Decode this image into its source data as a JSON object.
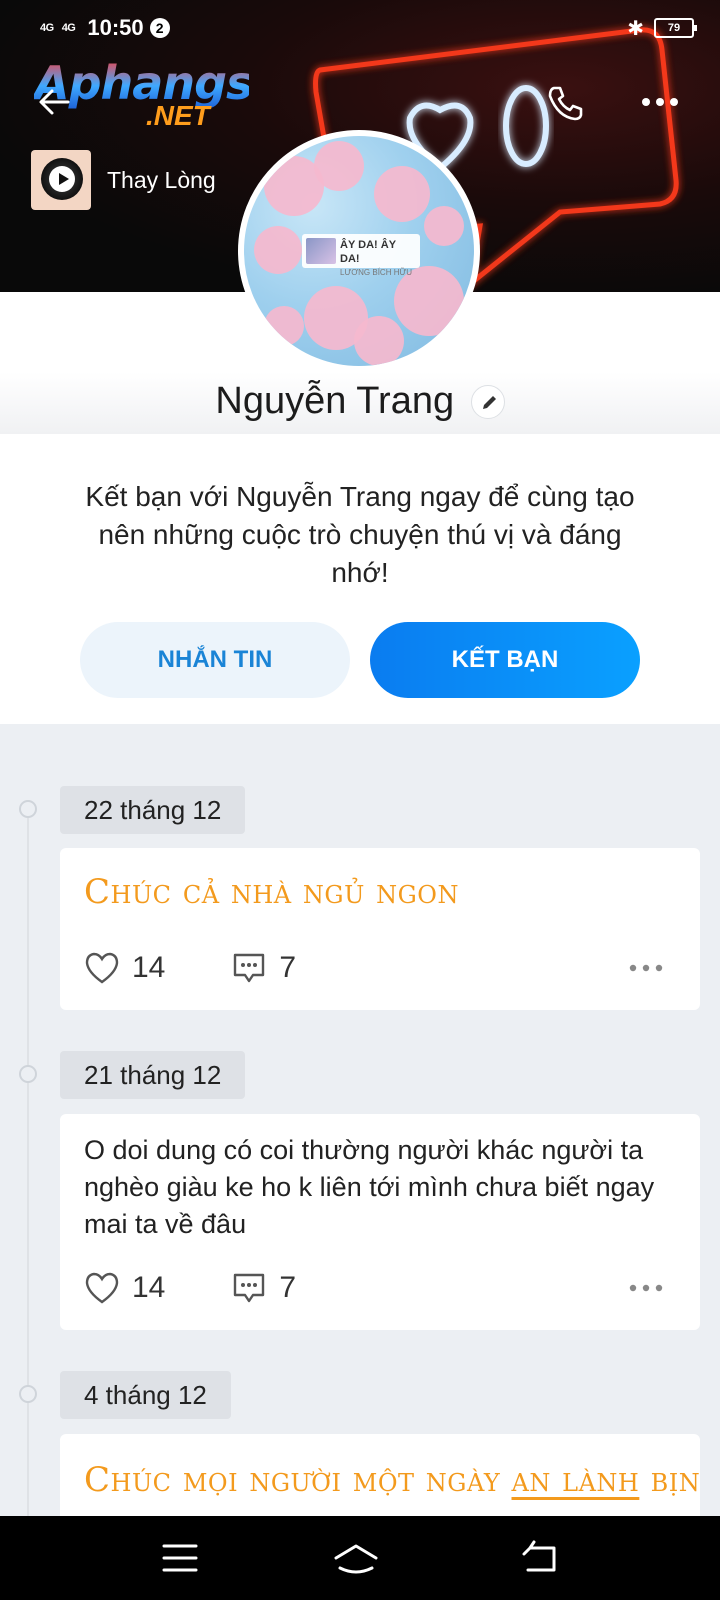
{
  "status_bar": {
    "signal_1": "4G",
    "signal_2": "4G",
    "time": "10:50",
    "notification_count": "2",
    "battery": "79"
  },
  "cover": {
    "watermark": {
      "main": "Aphangs",
      "sub": ".NET"
    },
    "music": {
      "title": "Thay Lòng"
    }
  },
  "avatar": {
    "tag_title": "ÂY DA! ÂY DA!",
    "tag_sub": "LƯƠNG BÍCH HỮU"
  },
  "profile": {
    "name": "Nguyễn Trang",
    "invite_text": "Kết bạn với Nguyễn Trang ngay để cùng tạo nên những cuộc trò chuyện thú vị và đáng nhớ!",
    "message_button": "NHẮN TIN",
    "add_friend_button": "KẾT BẠN"
  },
  "posts": [
    {
      "date": "22 tháng 12",
      "text": "Chúc cả nhà ngủ ngon",
      "likes": "14",
      "comments": "7"
    },
    {
      "date": "21 tháng 12",
      "text": "O doi dung có coi thường người khác người ta nghèo giàu ke ho k liên tới mình chưa biết ngay mai ta về đâu",
      "likes": "14",
      "comments": "7"
    },
    {
      "date": "4 tháng 12",
      "text_before": "Chúc mọi người một ngày ",
      "text_link": "an lành",
      "text_after": " bịnh"
    }
  ],
  "colors": {
    "accent_blue": "#0a8cf5",
    "fancy_text_orange": "#f39a1d",
    "background": "#eceff3"
  }
}
